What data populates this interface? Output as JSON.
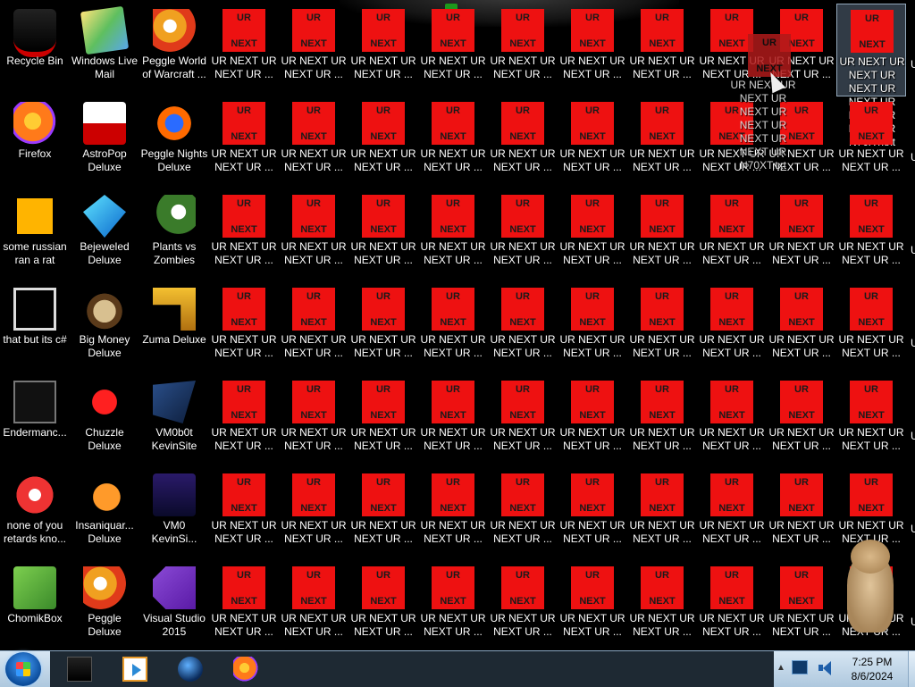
{
  "desktop": {
    "app_icons": [
      {
        "label": "Recycle Bin",
        "icon": "recycle-bin-icon",
        "art": "art-hat"
      },
      {
        "label": "Windows Live Mail",
        "icon": "windows-live-mail-icon",
        "art": "art-mail"
      },
      {
        "label": "Peggle World of Warcraft ...",
        "icon": "peggle-wow-icon",
        "art": "art-peggle"
      },
      {
        "label": "Firefox",
        "icon": "firefox-icon",
        "art": "art-firefox"
      },
      {
        "label": "AstroPop Deluxe",
        "icon": "astropop-icon",
        "art": "art-astro"
      },
      {
        "label": "Peggle Nights Deluxe",
        "icon": "peggle-nights-icon",
        "art": "art-nights"
      },
      {
        "label": "some russian ran a rat",
        "icon": "ruru-icon",
        "art": "art-ruru"
      },
      {
        "label": "Bejeweled Deluxe",
        "icon": "bejeweled-icon",
        "art": "art-bej"
      },
      {
        "label": "Plants vs Zombies",
        "icon": "plants-vs-zombies-icon",
        "art": "art-pvz"
      },
      {
        "label": "that but its c#",
        "icon": "csharp-shortcut-icon",
        "art": "art-csharp"
      },
      {
        "label": "Big Money Deluxe",
        "icon": "big-money-icon",
        "art": "art-money"
      },
      {
        "label": "Zuma Deluxe",
        "icon": "zuma-icon",
        "art": "art-zuma"
      },
      {
        "label": "Endermanc...",
        "icon": "endermanch-icon",
        "art": "art-ender"
      },
      {
        "label": "Chuzzle Deluxe",
        "icon": "chuzzle-icon",
        "art": "art-chuzzle"
      },
      {
        "label": "VM0b0t KevinSite",
        "icon": "vm0b0t-icon",
        "art": "art-vm"
      },
      {
        "label": "none of you retards kno...",
        "icon": "chrome-shortcut-icon",
        "art": "art-chrome"
      },
      {
        "label": "Insaniquar... Deluxe",
        "icon": "insaniquarium-icon",
        "art": "art-fish"
      },
      {
        "label": "VM0 KevinSi...",
        "icon": "vm0-icon",
        "art": "art-vm0"
      },
      {
        "label": "ChomikBox",
        "icon": "chomikbox-icon",
        "art": "art-chomik"
      },
      {
        "label": "Peggle Deluxe",
        "icon": "peggle-deluxe-icon",
        "art": "art-peggle"
      },
      {
        "label": "Visual Studio 2015",
        "icon": "visual-studio-icon",
        "art": "art-vs"
      }
    ],
    "file_icon": {
      "top_text": "UR",
      "bottom_text": "NEXT",
      "label": "UR NEXT UR NEXT UR ...",
      "color": "#ee1111"
    },
    "file_grid": {
      "rows": 7,
      "cols": 10
    },
    "selected_icon": {
      "row": 0,
      "col": 9
    },
    "selected_label": "UR NEXT UR NEXT UR NEXT UR NEXT UR NEXT UR NEXT UR N70XT.txt",
    "drag_ghost": {
      "top_text": "UR",
      "bottom_text": "NEXT",
      "label": "UR NEXT UR NEXT UR NEXT UR NEXT UR NEXT UR NEXT UR N70XT.txt"
    },
    "edge_char": "U"
  },
  "taskbar": {
    "start_icon": "windows-start-icon",
    "pinned": [
      {
        "name": "taskbar-explorer-icon",
        "art": "tb-screen"
      },
      {
        "name": "taskbar-media-player-icon",
        "art": "tb-media"
      },
      {
        "name": "taskbar-globe-icon",
        "art": "tb-globe"
      },
      {
        "name": "taskbar-firefox-icon",
        "art": "tb-fox"
      }
    ],
    "clock": {
      "time": "7:25 PM",
      "date": "8/6/2024"
    },
    "tray_expand": "▲"
  }
}
